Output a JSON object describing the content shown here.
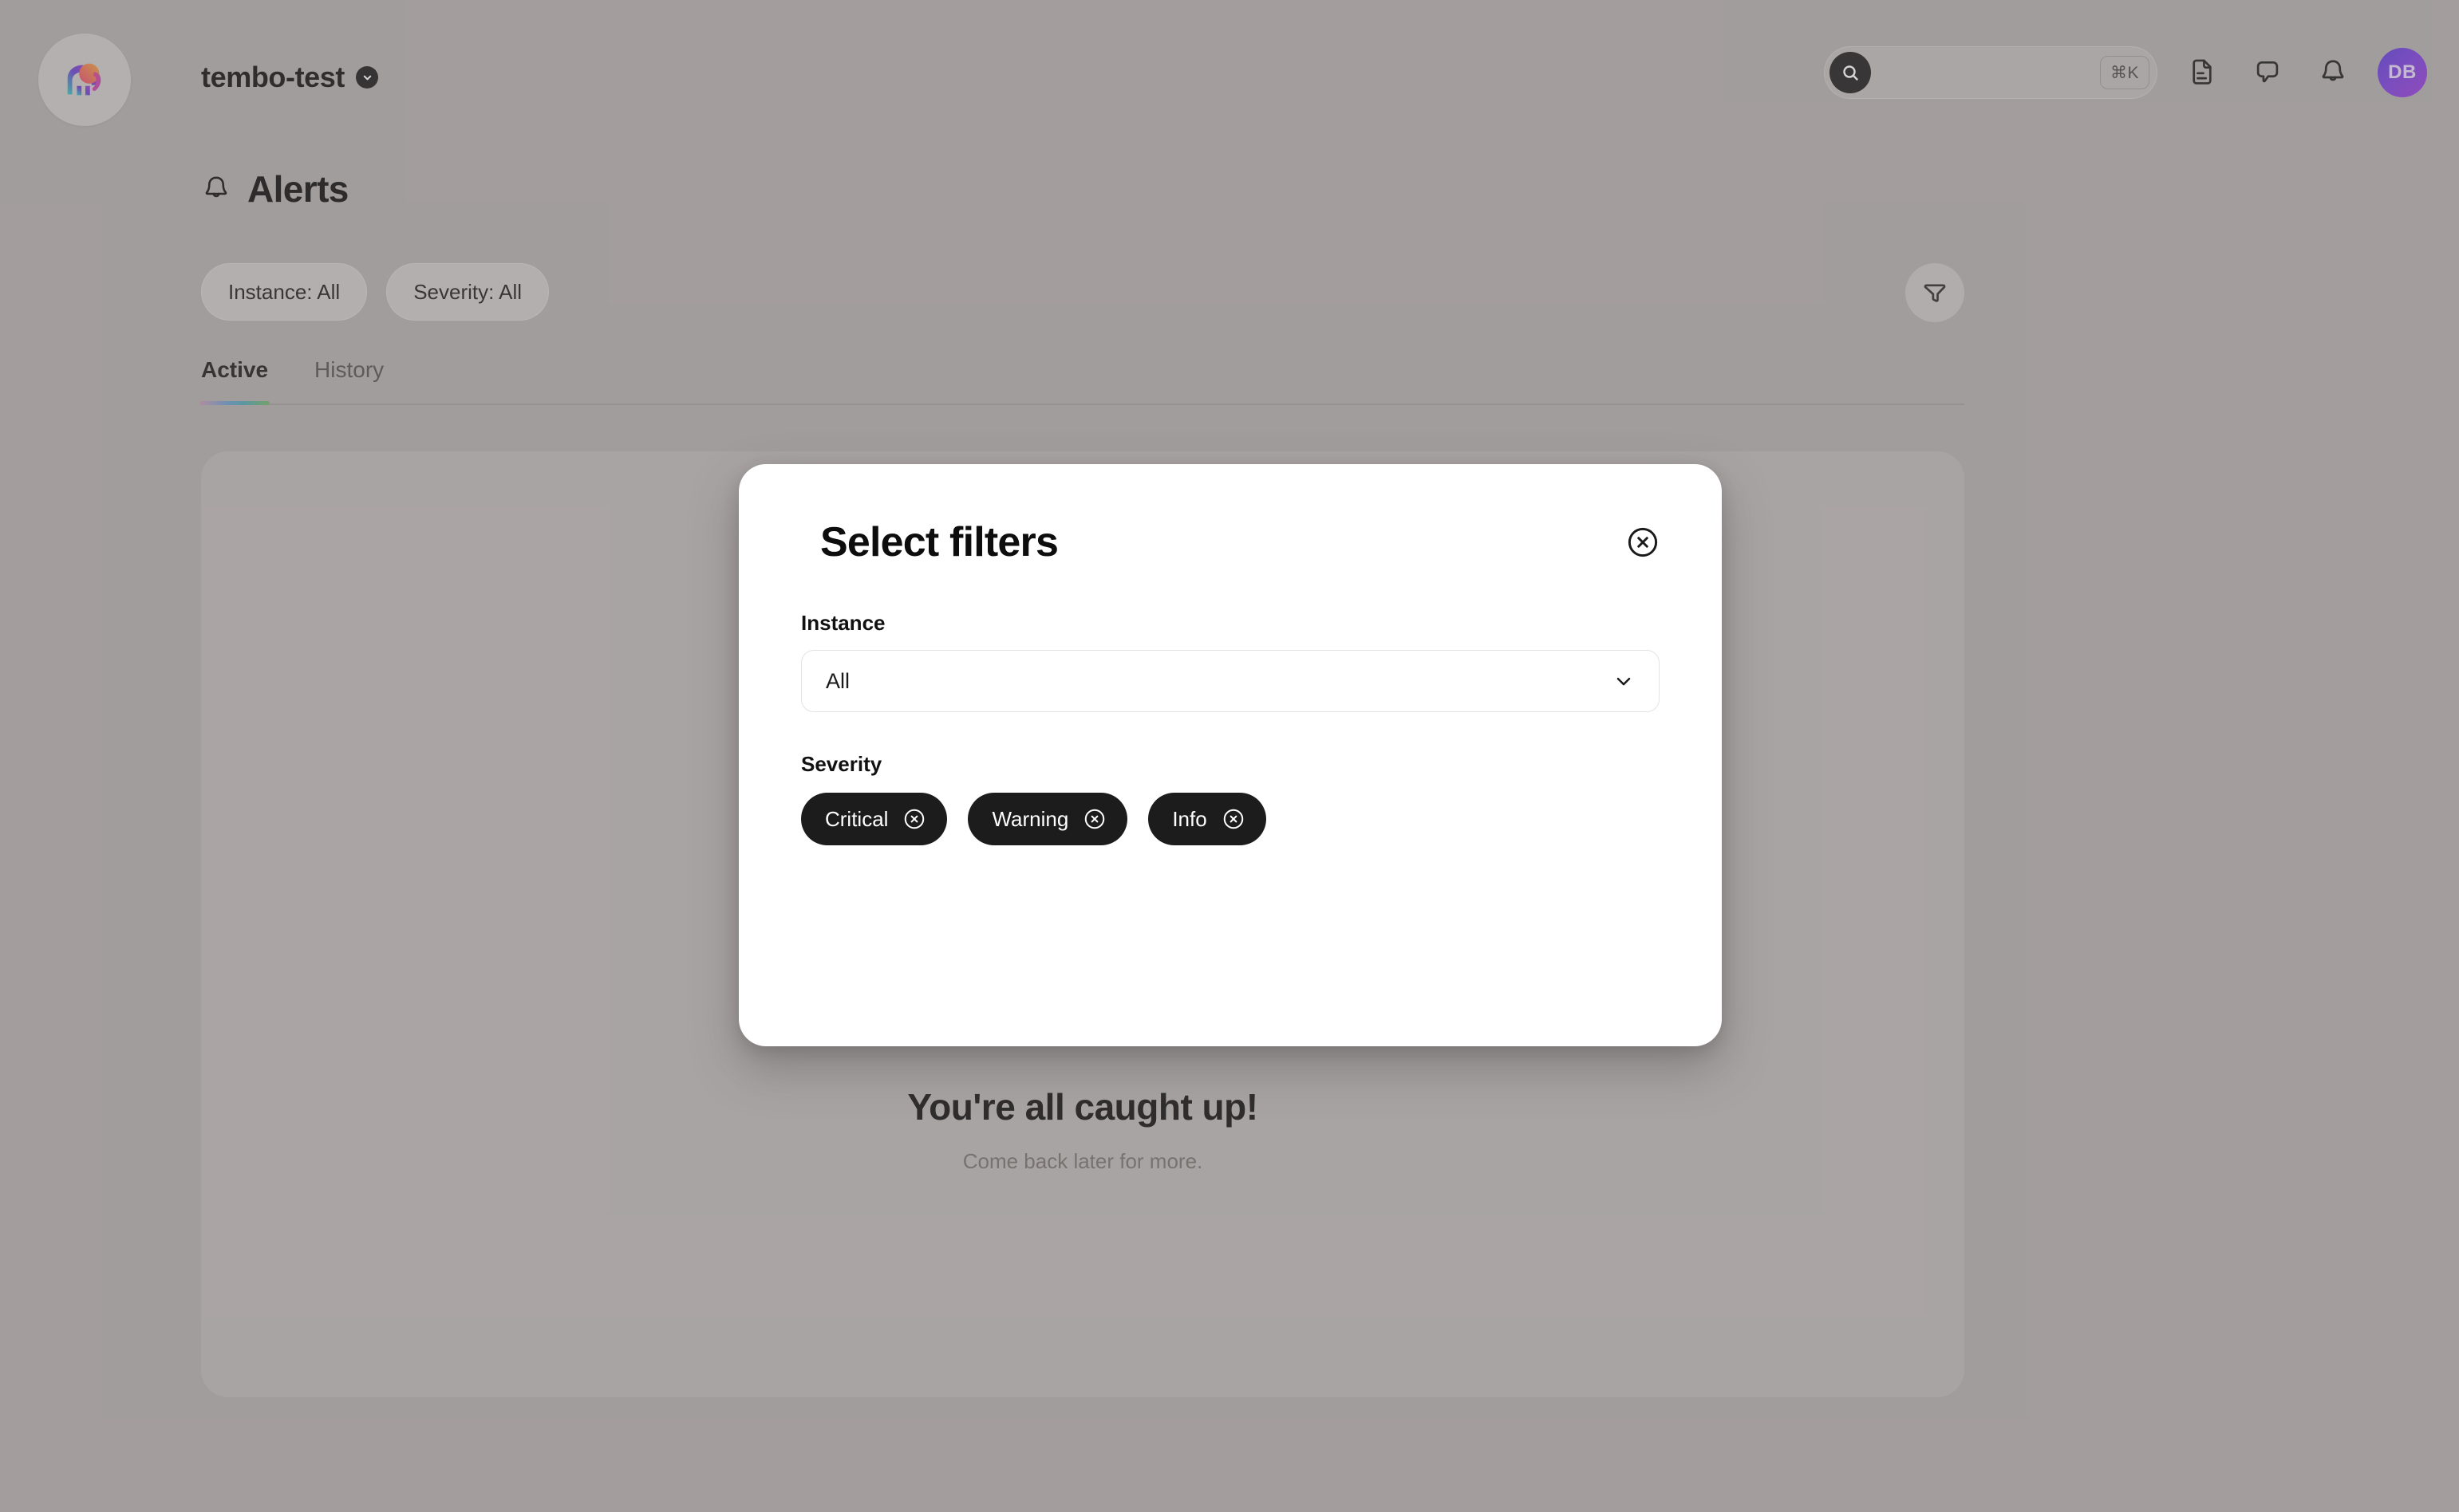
{
  "app": {
    "logo_icon": "tembo-elephant-logo",
    "workspace_name": "tembo-test",
    "workspace_caret_icon": "chevron-down-icon"
  },
  "topbar": {
    "search": {
      "icon": "search-icon",
      "value": "",
      "placeholder": "",
      "shortcut": "⌘K"
    },
    "icons": [
      {
        "name": "document-icon"
      },
      {
        "name": "chat-bubble-icon"
      },
      {
        "name": "bell-icon"
      }
    ],
    "avatar": {
      "initials": "DB",
      "gradient_from": "#5b3ddd",
      "gradient_to": "#9b3ddb"
    }
  },
  "page": {
    "icon": "bell-icon",
    "title": "Alerts"
  },
  "filters_bar": {
    "chips": [
      {
        "label": "Instance: All"
      },
      {
        "label": "Severity: All"
      }
    ],
    "filter_button_icon": "funnel-icon"
  },
  "tabs": [
    {
      "label": "Active",
      "active": true
    },
    {
      "label": "History",
      "active": false
    }
  ],
  "content": {
    "empty_title": "You're all caught up!",
    "empty_subtitle": "Come back later for more."
  },
  "modal": {
    "icon": "funnel-icon",
    "title": "Select filters",
    "close_icon": "close-circle-icon",
    "instance": {
      "label": "Instance",
      "selected": "All",
      "caret_icon": "chevron-down-icon"
    },
    "severity": {
      "label": "Severity",
      "chips": [
        {
          "label": "Critical",
          "remove_icon": "close-circle-icon"
        },
        {
          "label": "Warning",
          "remove_icon": "close-circle-icon"
        },
        {
          "label": "Info",
          "remove_icon": "close-circle-icon"
        }
      ]
    }
  },
  "colors": {
    "page_background": "#b5b0b0",
    "card_background": "#bfbbbb",
    "chip_dark": "#1c1c1c",
    "accent_gradient": "linear-gradient(90deg,#c79ab4,#6f9ed0,#4fa8b8,#74b866)"
  }
}
